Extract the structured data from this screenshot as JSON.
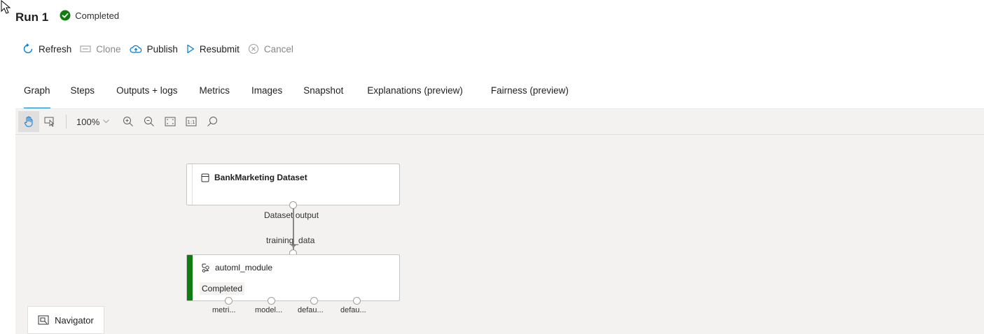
{
  "header": {
    "title": "Run 1",
    "status": "Completed",
    "status_color": "#107c10"
  },
  "actions": [
    {
      "label": "Refresh",
      "icon": "refresh-icon",
      "enabled": true
    },
    {
      "label": "Clone",
      "icon": "clone-icon",
      "enabled": false
    },
    {
      "label": "Publish",
      "icon": "cloud-upload-icon",
      "enabled": true
    },
    {
      "label": "Resubmit",
      "icon": "play-icon",
      "enabled": true
    },
    {
      "label": "Cancel",
      "icon": "cancel-icon",
      "enabled": false
    }
  ],
  "tabs": [
    {
      "label": "Graph",
      "active": true
    },
    {
      "label": "Steps",
      "active": false
    },
    {
      "label": "Outputs + logs",
      "active": false
    },
    {
      "label": "Metrics",
      "active": false
    },
    {
      "label": "Images",
      "active": false
    },
    {
      "label": "Snapshot",
      "active": false
    },
    {
      "label": "Explanations (preview)",
      "active": false
    },
    {
      "label": "Fairness (preview)",
      "active": false
    }
  ],
  "toolbar": {
    "zoom": "100%",
    "tools": [
      "pan-hand-icon",
      "select-icon",
      "zoom-in-icon",
      "zoom-out-icon",
      "fit-screen-icon",
      "actual-size-icon",
      "search-icon"
    ],
    "actual_size_label": "1:1"
  },
  "graph": {
    "dataset_node": {
      "title": "BankMarketing Dataset",
      "icon": "dataset-icon",
      "output_label": "Dataset output"
    },
    "module_node": {
      "title": "automl_module",
      "icon": "module-icon",
      "status": "Completed",
      "status_color": "#107c10",
      "input_label": "training_data",
      "outputs": [
        "metri...",
        "model...",
        "defau...",
        "defau..."
      ]
    }
  },
  "navigator": {
    "label": "Navigator",
    "icon": "navigator-icon"
  },
  "colors": {
    "accent": "#0078d4",
    "success": "#107c10",
    "canvas_bg": "#f3f2f1"
  }
}
